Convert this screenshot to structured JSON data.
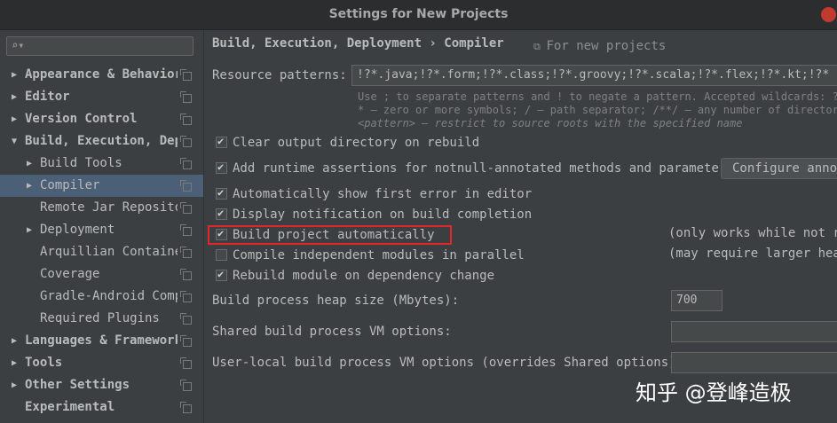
{
  "window": {
    "title": "Settings for New Projects"
  },
  "sidebar": {
    "search_placeholder": "",
    "search_icon": "search-icon",
    "items": [
      {
        "label": "Appearance & Behavior",
        "bold": true,
        "arrow": "right",
        "copy": true
      },
      {
        "label": "Editor",
        "bold": true,
        "arrow": "right",
        "copy": true
      },
      {
        "label": "Version Control",
        "bold": true,
        "arrow": "right",
        "copy": true
      },
      {
        "label": "Build, Execution, Depl",
        "bold": true,
        "arrow": "down",
        "copy": true
      },
      {
        "label": "Build Tools",
        "bold": false,
        "arrow": "right",
        "copy": true
      },
      {
        "label": "Compiler",
        "bold": false,
        "arrow": "right",
        "copy": true,
        "selected": true
      },
      {
        "label": "Remote Jar Repositor",
        "bold": false,
        "arrow": "",
        "copy": true
      },
      {
        "label": "Deployment",
        "bold": false,
        "arrow": "right",
        "copy": true
      },
      {
        "label": "Arquillian Container",
        "bold": false,
        "arrow": "",
        "copy": true
      },
      {
        "label": "Coverage",
        "bold": false,
        "arrow": "",
        "copy": true
      },
      {
        "label": "Gradle-Android Compi",
        "bold": false,
        "arrow": "",
        "copy": true
      },
      {
        "label": "Required Plugins",
        "bold": false,
        "arrow": "",
        "copy": true
      },
      {
        "label": "Languages & Frameworks",
        "bold": true,
        "arrow": "right",
        "copy": true
      },
      {
        "label": "Tools",
        "bold": true,
        "arrow": "right",
        "copy": true
      },
      {
        "label": "Other Settings",
        "bold": true,
        "arrow": "right",
        "copy": true
      },
      {
        "label": "Experimental",
        "bold": true,
        "arrow": "",
        "copy": true
      }
    ]
  },
  "main": {
    "breadcrumb": "Build, Execution, Deployment › Compiler",
    "for_new_projects": "For new projects",
    "resource_patterns": {
      "label": "Resource patterns:",
      "value": "!?*.java;!?*.form;!?*.class;!?*.groovy;!?*.scala;!?*.flex;!?*.kt;!?*",
      "hint1": "Use ; to separate patterns and ! to negate a pattern. Accepted wildcards: ? —",
      "hint2": "* — zero or more symbols; / — path separator; /**/ — any number of directorie",
      "hint3": "<pattern> — restrict to source roots with the specified name"
    },
    "checkboxes": [
      {
        "label": "Clear output directory on rebuild",
        "checked": true
      },
      {
        "label": "Add runtime assertions for notnull-annotated methods and parameters",
        "checked": true
      },
      {
        "label": "Automatically show first error in editor",
        "checked": true
      },
      {
        "label": "Display notification on build completion",
        "checked": true
      },
      {
        "label": "Build project automatically",
        "checked": true
      },
      {
        "label": "Compile independent modules in parallel",
        "checked": false
      },
      {
        "label": "Rebuild module on dependency change",
        "checked": true
      }
    ],
    "configure_button": "Configure annot",
    "note_only_works": "(only works while not ru",
    "note_may_require": "(may require larger heap",
    "heap": {
      "label": "Build process heap size (Mbytes):",
      "value": "700"
    },
    "shared_vm": {
      "label": "Shared build process VM options:",
      "value": ""
    },
    "user_vm": {
      "label": "User-local build process VM options (overrides Shared options):",
      "value": ""
    }
  },
  "watermark": "知乎 @登峰造极",
  "colors": {
    "background": "#3c3f41",
    "selection": "#4b5f76",
    "highlight_border": "#e3262a",
    "close_button": "#c23a2f"
  }
}
